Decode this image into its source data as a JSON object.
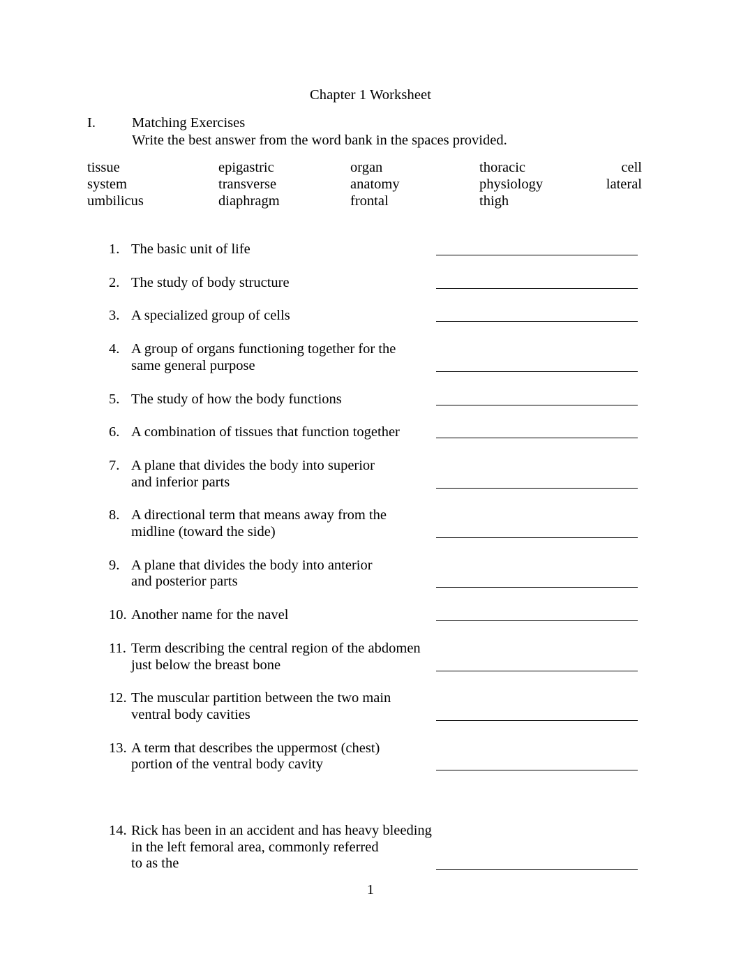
{
  "document": {
    "title": "Chapter 1 Worksheet",
    "page_number": "1"
  },
  "section": {
    "numeral": "I.",
    "heading": "Matching Exercises",
    "instruction": "Write the best answer from the word bank in the spaces provided."
  },
  "word_bank": {
    "rows": [
      {
        "c1": "tissue",
        "c2": "epigastric",
        "c3": "organ",
        "c4": "thoracic",
        "c5": "cell"
      },
      {
        "c1": "system",
        "c2": "transverse",
        "c3": "anatomy",
        "c4": "physiology",
        "c5": "lateral"
      },
      {
        "c1": "umbilicus",
        "c2": "diaphragm",
        "c3": "frontal",
        "c4": "thigh",
        "c5": ""
      }
    ]
  },
  "matching_items": [
    {
      "number": "1.",
      "lines": [
        "The basic unit of life"
      ]
    },
    {
      "number": "2.",
      "lines": [
        "The study of body structure"
      ]
    },
    {
      "number": "3.",
      "lines": [
        "A specialized group of cells"
      ]
    },
    {
      "number": "4.",
      "lines": [
        "A group of organs functioning together for the",
        "same general purpose"
      ]
    },
    {
      "number": "5.",
      "lines": [
        "The study of how the body functions"
      ]
    },
    {
      "number": "6.",
      "lines": [
        "A combination of tissues that function together"
      ]
    },
    {
      "number": "7.",
      "lines": [
        "A plane that divides the body into superior",
        "and inferior parts"
      ]
    },
    {
      "number": "8.",
      "lines": [
        "A directional term that means away from the",
        "midline (toward the side)"
      ]
    },
    {
      "number": "9.",
      "lines": [
        "A plane that divides the body into anterior",
        "and posterior parts"
      ]
    },
    {
      "number": "10.",
      "lines": [
        "Another name for the navel"
      ]
    },
    {
      "number": "11.",
      "lines": [
        "Term describing the central region of the abdomen",
        "just below the breast bone"
      ]
    },
    {
      "number": "12.",
      "lines": [
        "The muscular partition between the two main",
        "ventral body cavities"
      ]
    },
    {
      "number": "13.",
      "lines": [
        "A term that describes the uppermost (chest)",
        "portion of the ventral body cavity"
      ]
    },
    {
      "number": "14.",
      "lines": [
        "Rick has been in an accident and has heavy bleeding",
        "in the left femoral area, commonly referred",
        "to as the"
      ]
    }
  ]
}
